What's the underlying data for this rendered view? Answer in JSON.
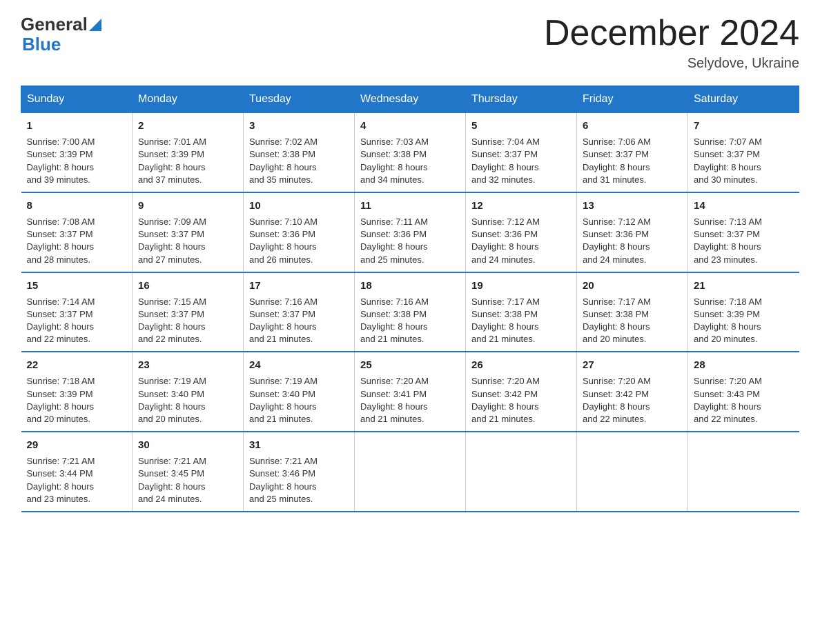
{
  "header": {
    "logo_general": "General",
    "logo_blue": "Blue",
    "month": "December 2024",
    "location": "Selydove, Ukraine"
  },
  "weekdays": [
    "Sunday",
    "Monday",
    "Tuesday",
    "Wednesday",
    "Thursday",
    "Friday",
    "Saturday"
  ],
  "weeks": [
    [
      {
        "day": "1",
        "sunrise": "7:00 AM",
        "sunset": "3:39 PM",
        "daylight": "8 hours and 39 minutes."
      },
      {
        "day": "2",
        "sunrise": "7:01 AM",
        "sunset": "3:39 PM",
        "daylight": "8 hours and 37 minutes."
      },
      {
        "day": "3",
        "sunrise": "7:02 AM",
        "sunset": "3:38 PM",
        "daylight": "8 hours and 35 minutes."
      },
      {
        "day": "4",
        "sunrise": "7:03 AM",
        "sunset": "3:38 PM",
        "daylight": "8 hours and 34 minutes."
      },
      {
        "day": "5",
        "sunrise": "7:04 AM",
        "sunset": "3:37 PM",
        "daylight": "8 hours and 32 minutes."
      },
      {
        "day": "6",
        "sunrise": "7:06 AM",
        "sunset": "3:37 PM",
        "daylight": "8 hours and 31 minutes."
      },
      {
        "day": "7",
        "sunrise": "7:07 AM",
        "sunset": "3:37 PM",
        "daylight": "8 hours and 30 minutes."
      }
    ],
    [
      {
        "day": "8",
        "sunrise": "7:08 AM",
        "sunset": "3:37 PM",
        "daylight": "8 hours and 28 minutes."
      },
      {
        "day": "9",
        "sunrise": "7:09 AM",
        "sunset": "3:37 PM",
        "daylight": "8 hours and 27 minutes."
      },
      {
        "day": "10",
        "sunrise": "7:10 AM",
        "sunset": "3:36 PM",
        "daylight": "8 hours and 26 minutes."
      },
      {
        "day": "11",
        "sunrise": "7:11 AM",
        "sunset": "3:36 PM",
        "daylight": "8 hours and 25 minutes."
      },
      {
        "day": "12",
        "sunrise": "7:12 AM",
        "sunset": "3:36 PM",
        "daylight": "8 hours and 24 minutes."
      },
      {
        "day": "13",
        "sunrise": "7:12 AM",
        "sunset": "3:36 PM",
        "daylight": "8 hours and 24 minutes."
      },
      {
        "day": "14",
        "sunrise": "7:13 AM",
        "sunset": "3:37 PM",
        "daylight": "8 hours and 23 minutes."
      }
    ],
    [
      {
        "day": "15",
        "sunrise": "7:14 AM",
        "sunset": "3:37 PM",
        "daylight": "8 hours and 22 minutes."
      },
      {
        "day": "16",
        "sunrise": "7:15 AM",
        "sunset": "3:37 PM",
        "daylight": "8 hours and 22 minutes."
      },
      {
        "day": "17",
        "sunrise": "7:16 AM",
        "sunset": "3:37 PM",
        "daylight": "8 hours and 21 minutes."
      },
      {
        "day": "18",
        "sunrise": "7:16 AM",
        "sunset": "3:38 PM",
        "daylight": "8 hours and 21 minutes."
      },
      {
        "day": "19",
        "sunrise": "7:17 AM",
        "sunset": "3:38 PM",
        "daylight": "8 hours and 21 minutes."
      },
      {
        "day": "20",
        "sunrise": "7:17 AM",
        "sunset": "3:38 PM",
        "daylight": "8 hours and 20 minutes."
      },
      {
        "day": "21",
        "sunrise": "7:18 AM",
        "sunset": "3:39 PM",
        "daylight": "8 hours and 20 minutes."
      }
    ],
    [
      {
        "day": "22",
        "sunrise": "7:18 AM",
        "sunset": "3:39 PM",
        "daylight": "8 hours and 20 minutes."
      },
      {
        "day": "23",
        "sunrise": "7:19 AM",
        "sunset": "3:40 PM",
        "daylight": "8 hours and 20 minutes."
      },
      {
        "day": "24",
        "sunrise": "7:19 AM",
        "sunset": "3:40 PM",
        "daylight": "8 hours and 21 minutes."
      },
      {
        "day": "25",
        "sunrise": "7:20 AM",
        "sunset": "3:41 PM",
        "daylight": "8 hours and 21 minutes."
      },
      {
        "day": "26",
        "sunrise": "7:20 AM",
        "sunset": "3:42 PM",
        "daylight": "8 hours and 21 minutes."
      },
      {
        "day": "27",
        "sunrise": "7:20 AM",
        "sunset": "3:42 PM",
        "daylight": "8 hours and 22 minutes."
      },
      {
        "day": "28",
        "sunrise": "7:20 AM",
        "sunset": "3:43 PM",
        "daylight": "8 hours and 22 minutes."
      }
    ],
    [
      {
        "day": "29",
        "sunrise": "7:21 AM",
        "sunset": "3:44 PM",
        "daylight": "8 hours and 23 minutes."
      },
      {
        "day": "30",
        "sunrise": "7:21 AM",
        "sunset": "3:45 PM",
        "daylight": "8 hours and 24 minutes."
      },
      {
        "day": "31",
        "sunrise": "7:21 AM",
        "sunset": "3:46 PM",
        "daylight": "8 hours and 25 minutes."
      },
      null,
      null,
      null,
      null
    ]
  ],
  "labels": {
    "sunrise": "Sunrise:",
    "sunset": "Sunset:",
    "daylight": "Daylight:"
  }
}
